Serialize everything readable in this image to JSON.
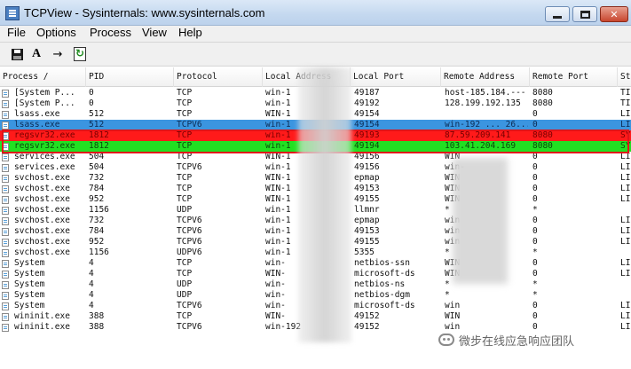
{
  "window": {
    "title": "TCPView - Sysinternals: www.sysinternals.com"
  },
  "menu": [
    "File",
    "Options",
    "Process",
    "View",
    "Help"
  ],
  "toolbar": {
    "icons": [
      "save-icon",
      "font-icon",
      "arrow-icon",
      "refresh-icon"
    ],
    "font_label": "A",
    "arrow_label": "→"
  },
  "columns": [
    "Process  /",
    "PID",
    "Protocol",
    "Local Address",
    "Local Port",
    "Remote Address",
    "Remote Port",
    "St"
  ],
  "rows": [
    [
      "[System P...",
      "0",
      "TCP",
      "win-1",
      "49187",
      "host-185.184.---",
      "8080",
      "TIN"
    ],
    [
      "[System P...",
      "0",
      "TCP",
      "win-1",
      "49192",
      "128.199.192.135",
      "8080",
      "TIN"
    ],
    [
      "lsass.exe",
      "512",
      "TCP",
      "WIN-1",
      "49154",
      "",
      "0",
      "LIS"
    ],
    [
      "lsass.exe",
      "512",
      "TCPV6",
      "win-1",
      "49154",
      "win-192 ... 26...",
      "0",
      "LIS"
    ],
    [
      "regsvr32.exe",
      "1812",
      "TCP",
      "win-1",
      "49193",
      "87.59.209.141",
      "8080",
      "SY"
    ],
    [
      "regsvr32.exe",
      "1812",
      "TCP",
      "win-1",
      "49194",
      "103.41.204.169",
      "8080",
      "SY"
    ],
    [
      "services.exe",
      "504",
      "TCP",
      "WIN-1",
      "49156",
      "WIN",
      "0",
      "LIS"
    ],
    [
      "services.exe",
      "504",
      "TCPV6",
      "win-1",
      "49156",
      "win-",
      "0",
      "LIS"
    ],
    [
      "svchost.exe",
      "732",
      "TCP",
      "WIN-1",
      "epmap",
      "WIN",
      "0",
      "LIS"
    ],
    [
      "svchost.exe",
      "784",
      "TCP",
      "WIN-1",
      "49153",
      "WIN",
      "0",
      "LIS"
    ],
    [
      "svchost.exe",
      "952",
      "TCP",
      "WIN-1",
      "49155",
      "WIN",
      "0",
      "LIS"
    ],
    [
      "svchost.exe",
      "1156",
      "UDP",
      "win-1",
      "llmnr",
      "*",
      "*",
      ""
    ],
    [
      "svchost.exe",
      "732",
      "TCPV6",
      "win-1",
      "epmap",
      "win",
      "0",
      "LIS"
    ],
    [
      "svchost.exe",
      "784",
      "TCPV6",
      "win-1",
      "49153",
      "win",
      "0",
      "LIS"
    ],
    [
      "svchost.exe",
      "952",
      "TCPV6",
      "win-1",
      "49155",
      "win",
      "0",
      "LIS"
    ],
    [
      "svchost.exe",
      "1156",
      "UDPV6",
      "win-1",
      "5355",
      "*",
      "*",
      ""
    ],
    [
      "System",
      "4",
      "TCP",
      "win-",
      "netbios-ssn",
      "WIN",
      "0",
      "LIS"
    ],
    [
      "System",
      "4",
      "TCP",
      "WIN-",
      "microsoft-ds",
      "WIN",
      "0",
      "LIS"
    ],
    [
      "System",
      "4",
      "UDP",
      "win-",
      "netbios-ns",
      "*",
      "*",
      ""
    ],
    [
      "System",
      "4",
      "UDP",
      "win-",
      "netbios-dgm",
      "*",
      "*",
      ""
    ],
    [
      "System",
      "4",
      "TCPV6",
      "win-",
      "microsoft-ds",
      "win",
      "0",
      "LIS"
    ],
    [
      "wininit.exe",
      "388",
      "TCP",
      "WIN-",
      "49152",
      "WIN",
      "0",
      "LIS"
    ],
    [
      "wininit.exe",
      "388",
      "TCPV6",
      "win-192",
      "49152",
      "win",
      "0",
      "LIS"
    ]
  ],
  "row_highlights": {
    "3": "blue",
    "4": "red",
    "5": "green"
  },
  "colors": {
    "blue": "#3b95e0",
    "red": "#ff1a1a",
    "green": "#22e022",
    "box": "#e0141a"
  },
  "watermark": "微步在线应急响应团队"
}
